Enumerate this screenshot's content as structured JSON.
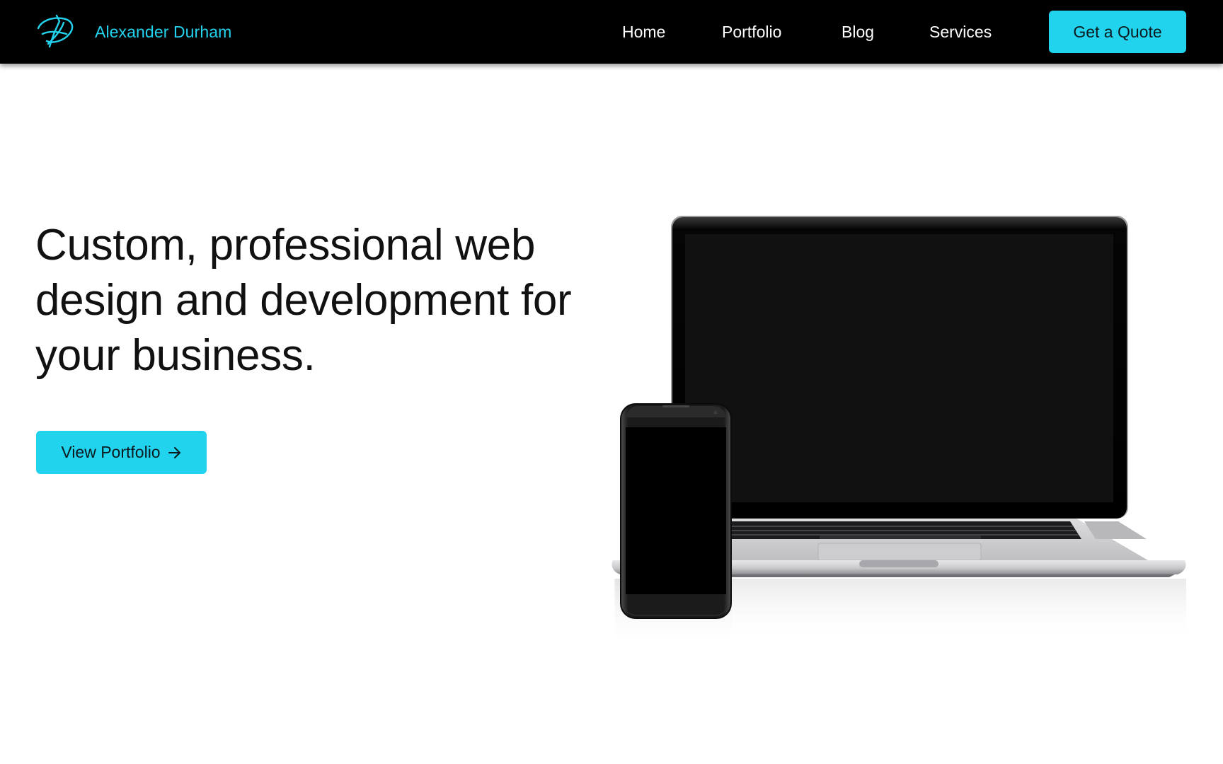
{
  "brand": {
    "name": "Alexander Durham",
    "logo_icon": "signature-logo-icon",
    "accent_color": "#22d3ee"
  },
  "nav": {
    "links": [
      {
        "label": "Home"
      },
      {
        "label": "Portfolio"
      },
      {
        "label": "Blog"
      },
      {
        "label": "Services"
      }
    ],
    "cta_label": "Get a Quote"
  },
  "hero": {
    "title": "Custom, professional web design and development for your business.",
    "button_label": "View Portfolio",
    "button_icon": "arrow-right-icon",
    "image": {
      "laptop_icon": "laptop-icon",
      "phone_icon": "smartphone-icon"
    }
  }
}
